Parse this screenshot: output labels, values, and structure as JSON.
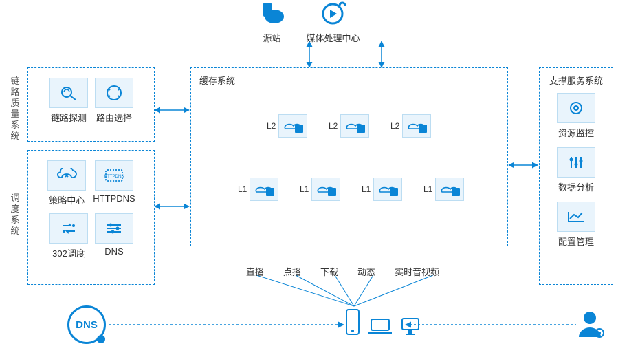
{
  "top": {
    "origin": "源站",
    "mediaCenter": "媒体处理中心"
  },
  "leftPanels": {
    "linkQuality": {
      "title": "链路质量系统",
      "tiles": [
        "链路探测",
        "路由选择"
      ]
    },
    "scheduling": {
      "title": "调度系统",
      "tiles": [
        "策略中心",
        "HTTPDNS",
        "302调度",
        "DNS"
      ]
    }
  },
  "cache": {
    "title": "缓存系统",
    "l2": [
      "L2",
      "L2",
      "L2"
    ],
    "l1": [
      "L1",
      "L1",
      "L1",
      "L1"
    ]
  },
  "right": {
    "title": "支撑服务系统",
    "tiles": [
      "资源监控",
      "数据分析",
      "配置管理"
    ]
  },
  "services": [
    "直播",
    "点播",
    "下载",
    "动态",
    "实时音视频"
  ],
  "dns": "DNS",
  "colors": {
    "primary": "#0a85d6",
    "tileBg": "#e9f4fc",
    "tileBorder": "#bcddf2"
  }
}
